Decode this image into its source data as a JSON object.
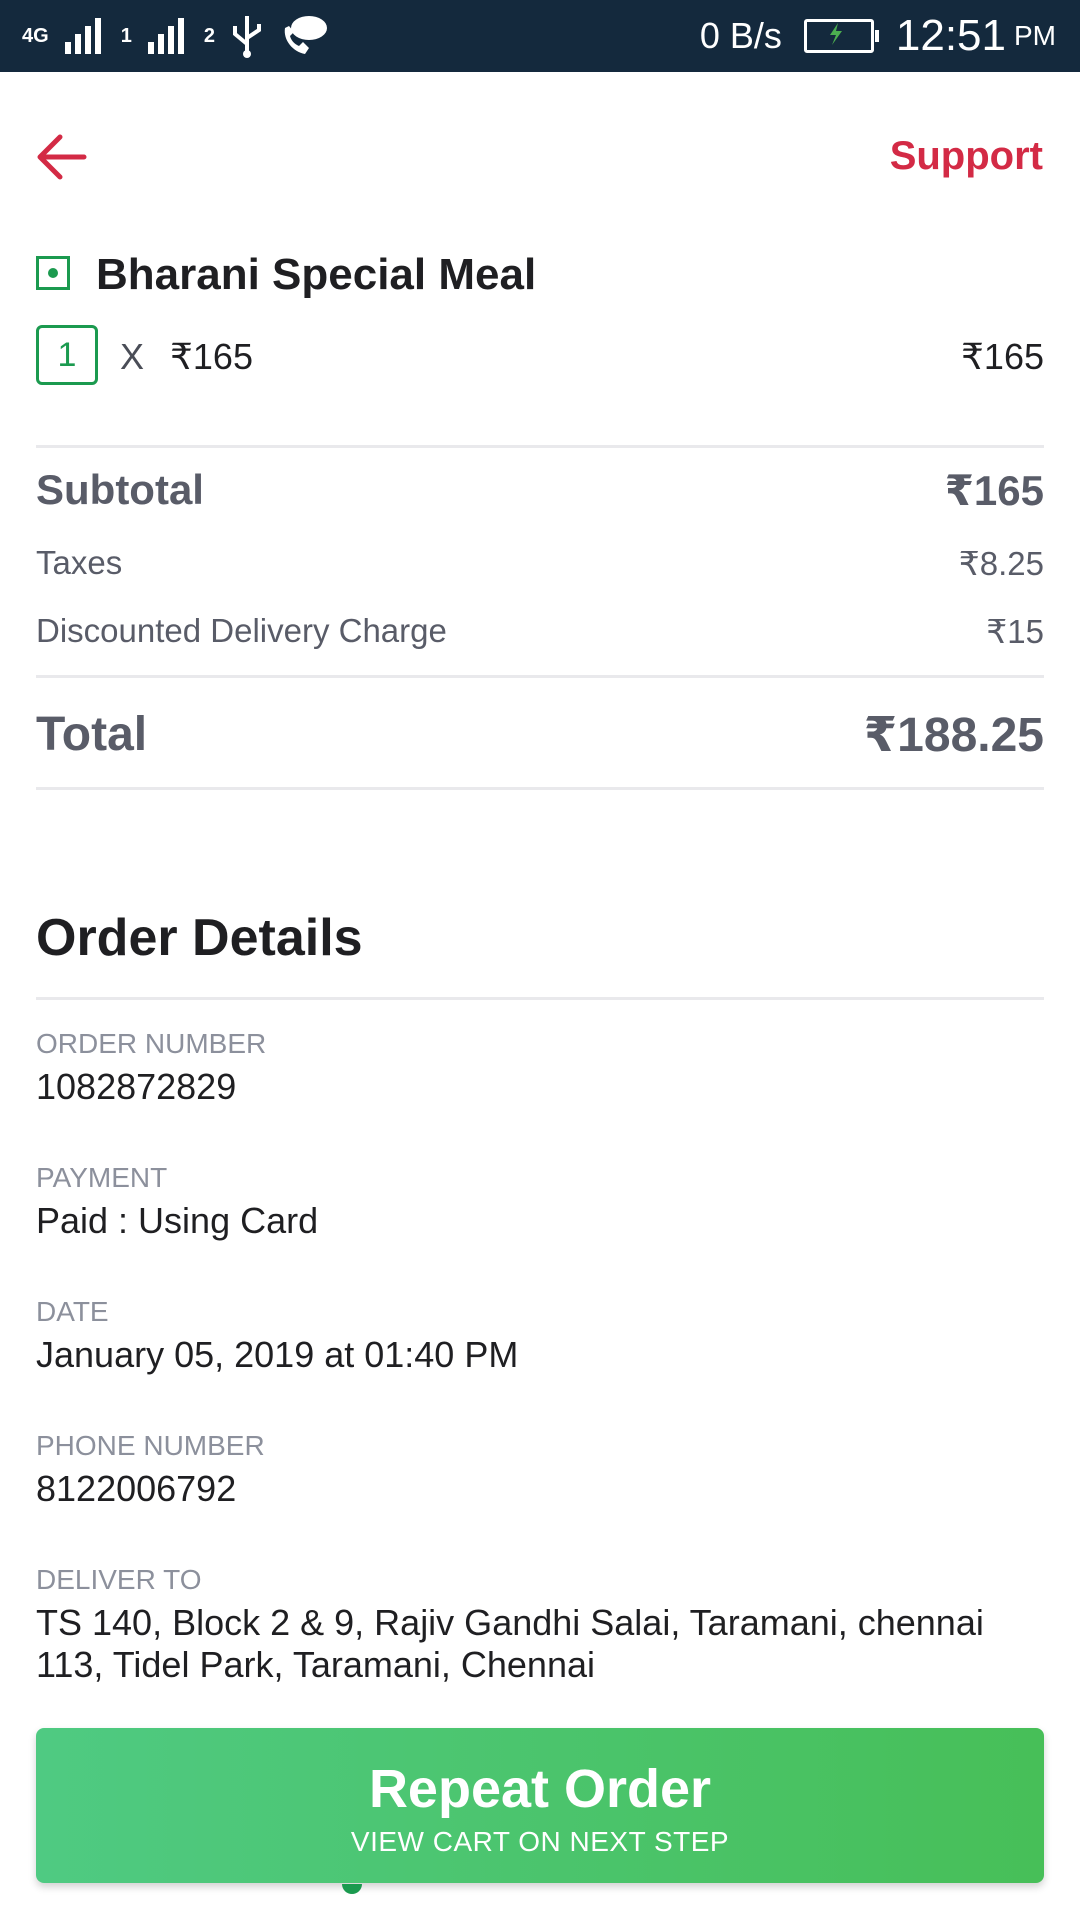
{
  "status_bar": {
    "network": "4G",
    "sim1": "1",
    "sim2": "2",
    "speed": "0 B/s",
    "time": "12:51",
    "ampm": "PM"
  },
  "header": {
    "support_label": "Support"
  },
  "item": {
    "name": "Bharani Special Meal",
    "quantity": "1",
    "times": "X",
    "unit_price": "₹165",
    "line_price": "₹165"
  },
  "bill": {
    "subtotal_label": "Subtotal",
    "subtotal_value": "₹165",
    "taxes_label": "Taxes",
    "taxes_value": "₹8.25",
    "delivery_label": "Discounted Delivery Charge",
    "delivery_value": "₹15",
    "total_label": "Total",
    "total_value": "₹188.25"
  },
  "order_details": {
    "title": "Order Details",
    "order_number_label": "ORDER NUMBER",
    "order_number": "1082872829",
    "payment_label": "PAYMENT",
    "payment": "Paid : Using Card",
    "date_label": "DATE",
    "date": "January 05, 2019 at 01:40 PM",
    "phone_label": "PHONE NUMBER",
    "phone": "8122006792",
    "deliver_label": "DELIVER TO",
    "address": "TS 140, Block 2 & 9, Rajiv Gandhi Salai, Taramani, chennai 113, Tidel Park, Taramani, Chennai"
  },
  "action": {
    "repeat_label": "Repeat Order",
    "repeat_sub": "VIEW CART ON NEXT STEP"
  },
  "colors": {
    "accent": "#d32a45",
    "veg_green": "#1b9a4f",
    "button_green": "#48c06a",
    "status_bar": "#14293d"
  }
}
